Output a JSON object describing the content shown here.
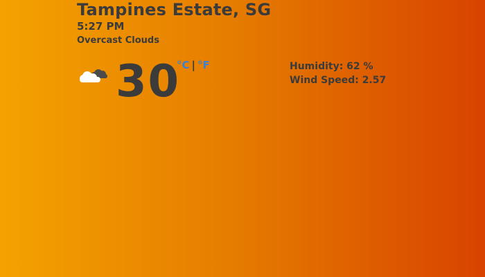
{
  "weather": {
    "location": "Tampines Estate, SG",
    "time": "5:27 PM",
    "description": "Overcast Clouds",
    "icon": "overcast-clouds-icon",
    "temperature": "30",
    "unit_celsius": "°C",
    "unit_separator": "|",
    "unit_fahrenheit": "°F",
    "humidity": "Humidity: 62 %",
    "wind_speed": "Wind Speed: 2.57"
  },
  "colors": {
    "background_start": "#f4a200",
    "background_end": "#d84300",
    "text": "#3b3b3b",
    "unit_link": "#3f7fd6"
  }
}
